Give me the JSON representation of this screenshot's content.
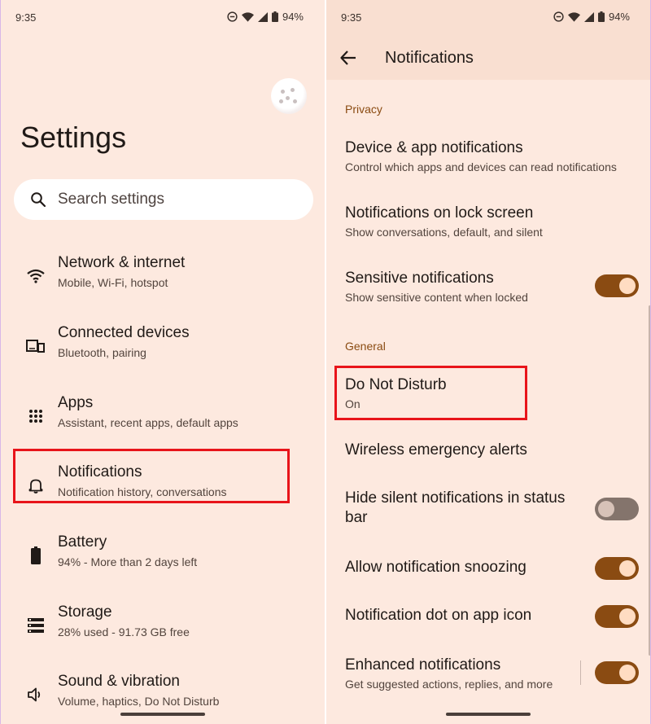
{
  "left": {
    "status": {
      "time": "9:35",
      "battery": "94%"
    },
    "title": "Settings",
    "search": {
      "placeholder": "Search settings"
    },
    "items": [
      {
        "title": "Network & internet",
        "subtitle": "Mobile, Wi-Fi, hotspot",
        "icon": "wifi-icon"
      },
      {
        "title": "Connected devices",
        "subtitle": "Bluetooth, pairing",
        "icon": "devices-icon"
      },
      {
        "title": "Apps",
        "subtitle": "Assistant, recent apps, default apps",
        "icon": "apps-grid-icon"
      },
      {
        "title": "Notifications",
        "subtitle": "Notification history, conversations",
        "icon": "bell-icon"
      },
      {
        "title": "Battery",
        "subtitle": "94% - More than 2 days left",
        "icon": "battery-icon"
      },
      {
        "title": "Storage",
        "subtitle": "28% used - 91.73 GB free",
        "icon": "storage-icon"
      },
      {
        "title": "Sound & vibration",
        "subtitle": "Volume, haptics, Do Not Disturb",
        "icon": "speaker-icon"
      }
    ]
  },
  "right": {
    "status": {
      "time": "9:35",
      "battery": "94%"
    },
    "title": "Notifications",
    "sections": {
      "privacy": "Privacy",
      "general": "General"
    },
    "items": [
      {
        "title": "Device & app notifications",
        "subtitle": "Control which apps and devices can read notifications"
      },
      {
        "title": "Notifications on lock screen",
        "subtitle": "Show conversations, default, and silent"
      },
      {
        "title": "Sensitive notifications",
        "subtitle": "Show sensitive content when locked",
        "toggle": true
      },
      {
        "title": "Do Not Disturb",
        "subtitle": "On"
      },
      {
        "title": "Wireless emergency alerts"
      },
      {
        "title": "Hide silent notifications in status bar",
        "toggle": false
      },
      {
        "title": "Allow notification snoozing",
        "toggle": true
      },
      {
        "title": "Notification dot on app icon",
        "toggle": true
      },
      {
        "title": "Enhanced notifications",
        "subtitle": "Get suggested actions, replies, and more",
        "toggle": true
      }
    ]
  },
  "colors": {
    "background": "#fde9df",
    "accent": "#8a4b12",
    "highlight": "#e8141a"
  }
}
